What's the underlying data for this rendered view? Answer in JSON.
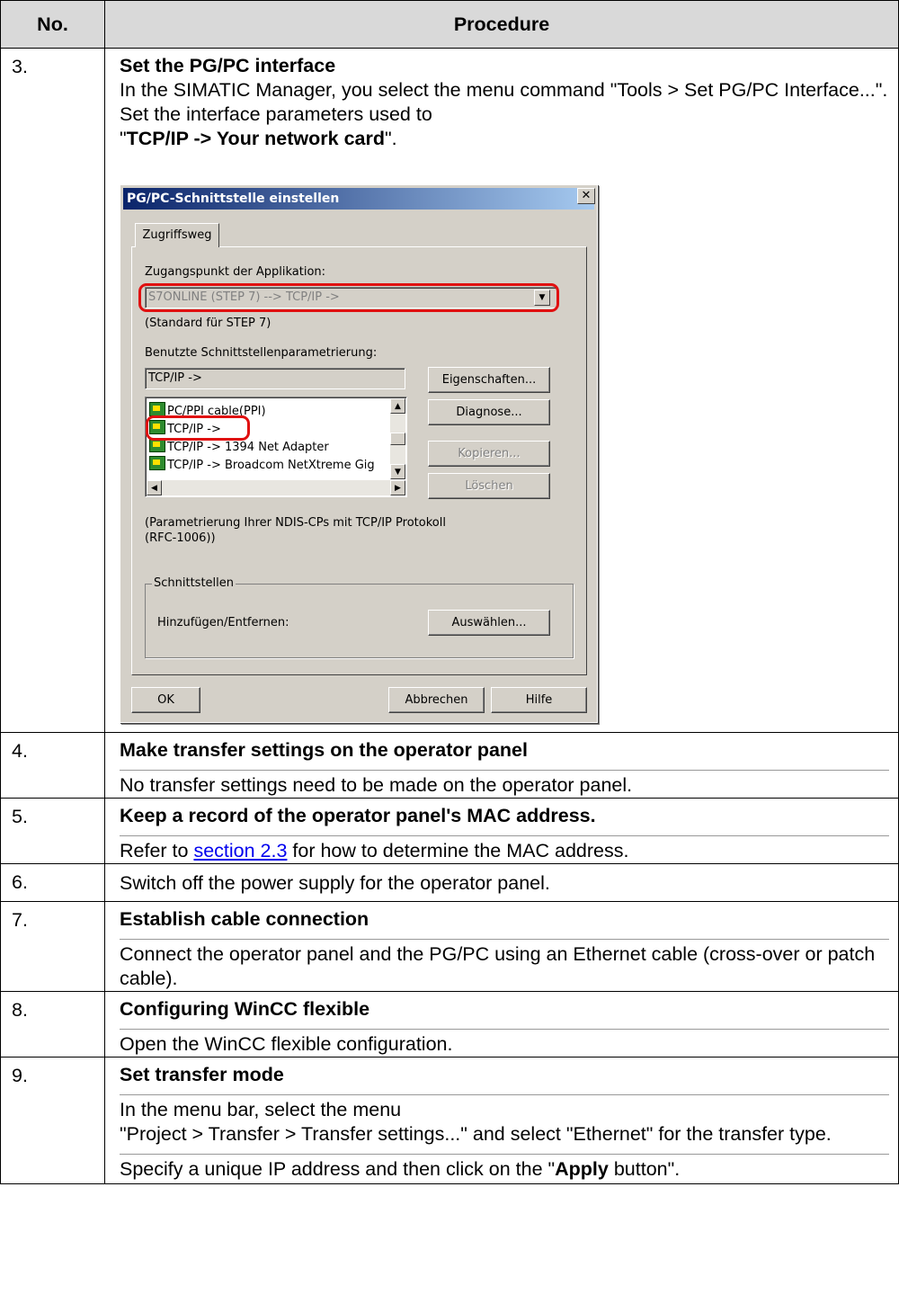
{
  "table": {
    "col_no": "No.",
    "col_proc": "Procedure"
  },
  "rows": [
    {
      "no": "3.",
      "title": "Set the PG/PC interface",
      "text1": "In the SIMATIC Manager, you select the menu command \"Tools > Set PG/PC Interface...\".",
      "text2": "Set the interface parameters used to",
      "text3a": "\"",
      "text3b": "TCP/IP -> Your network card",
      "text3c": "\"."
    },
    {
      "no": "4.",
      "title": "Make transfer settings on the operator panel",
      "text": "No transfer settings need to be made on the operator panel."
    },
    {
      "no": "5.",
      "title": "Keep a record of the operator panel's MAC address.",
      "text_a": "Refer to ",
      "link": "section 2.3",
      "text_b": " for how to determine the MAC address."
    },
    {
      "no": "6.",
      "text": "Switch off the power supply for the operator panel."
    },
    {
      "no": "7.",
      "title": "Establish cable connection",
      "text": "Connect the operator panel and the PG/PC using an Ethernet cable (cross-over or patch cable)."
    },
    {
      "no": "8.",
      "title": "Configuring WinCC flexible",
      "text": "Open the WinCC flexible configuration."
    },
    {
      "no": "9.",
      "title": "Set transfer mode",
      "text1": "In the menu bar, select the menu",
      "text2": "\"Project > Transfer > Transfer settings...\" and select \"Ethernet\" for the transfer type.",
      "text3a": "Specify a unique IP address and then click on the \"",
      "text3b": "Apply",
      "text3c": " button\"."
    }
  ],
  "dialog": {
    "title": "PG/PC-Schnittstelle einstellen",
    "close": "✕",
    "tab": "Zugriffsweg",
    "access_label": "Zugangspunkt der Applikation:",
    "access_value": "S7ONLINE    (STEP 7)    --> TCP/IP ->",
    "access_hint": "(Standard für STEP 7)",
    "param_label": "Benutzte Schnittstellenparametrierung:",
    "param_value": "TCP/IP ->",
    "list_items": [
      "PC/PPI cable(PPI)",
      "TCP/IP ->",
      "TCP/IP -> 1394 Net Adapter",
      "TCP/IP -> Broadcom NetXtreme Gig"
    ],
    "btn_properties": "Eigenschaften...",
    "btn_diagnose": "Diagnose...",
    "btn_copy": "Kopieren...",
    "btn_delete": "Löschen",
    "description": "(Parametrierung Ihrer NDIS-CPs mit TCP/IP Protokoll (RFC-1006))",
    "group_title": "Schnittstellen",
    "group_label": "Hinzufügen/Entfernen:",
    "btn_select": "Auswählen...",
    "btn_ok": "OK",
    "btn_cancel": "Abbrechen",
    "btn_help": "Hilfe"
  }
}
